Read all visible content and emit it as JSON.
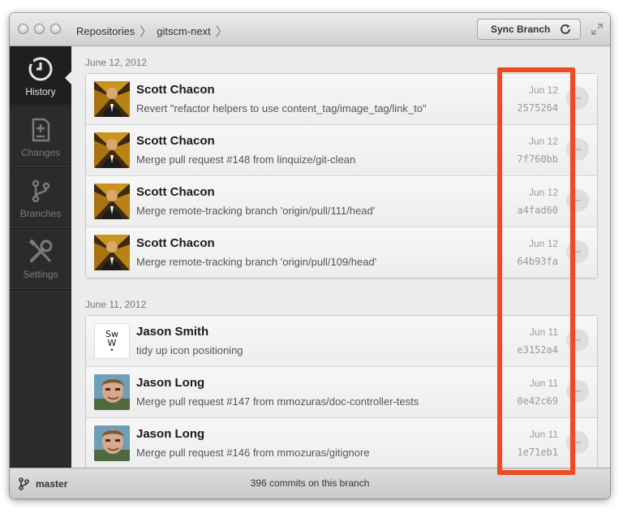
{
  "breadcrumbs": [
    "Repositories",
    "gitscm-next"
  ],
  "toolbar": {
    "sync_label": "Sync Branch"
  },
  "sidebar": {
    "items": [
      {
        "label": "History",
        "icon": "history-icon",
        "active": true
      },
      {
        "label": "Changes",
        "icon": "changes-icon",
        "active": false
      },
      {
        "label": "Branches",
        "icon": "branches-icon",
        "active": false
      },
      {
        "label": "Settings",
        "icon": "settings-icon",
        "active": false
      }
    ]
  },
  "groups": [
    {
      "date": "June 12, 2012",
      "commits": [
        {
          "author": "Scott Chacon",
          "message": "Revert \"refactor helpers to use content_tag/image_tag/link_to\"",
          "date": "Jun 12",
          "sha": "2575264"
        },
        {
          "author": "Scott Chacon",
          "message": "Merge pull request #148 from linquize/git-clean",
          "date": "Jun 12",
          "sha": "7f760bb"
        },
        {
          "author": "Scott Chacon",
          "message": "Merge remote-tracking branch 'origin/pull/111/head'",
          "date": "Jun 12",
          "sha": "a4fad60"
        },
        {
          "author": "Scott Chacon",
          "message": "Merge remote-tracking branch 'origin/pull/109/head'",
          "date": "Jun 12",
          "sha": "64b93fa"
        }
      ]
    },
    {
      "date": "June 11, 2012",
      "commits": [
        {
          "author": "Jason Smith",
          "message": "tidy up icon positioning",
          "date": "Jun 11",
          "sha": "e3152a4"
        },
        {
          "author": "Jason Long",
          "message": "Merge pull request #147 from mmozuras/doc-controller-tests",
          "date": "Jun 11",
          "sha": "0e42c69"
        },
        {
          "author": "Jason Long",
          "message": "Merge pull request #146 from mmozuras/gitignore",
          "date": "Jun 11",
          "sha": "1e71eb1"
        }
      ]
    }
  ],
  "status": {
    "branch": "master",
    "commit_count": "396 commits on this branch"
  },
  "avatar_logo": {
    "line1": "Sw",
    "line2": "W"
  },
  "colors": {
    "highlight": "#f04a23",
    "sidebar": "#2b2b2b"
  }
}
